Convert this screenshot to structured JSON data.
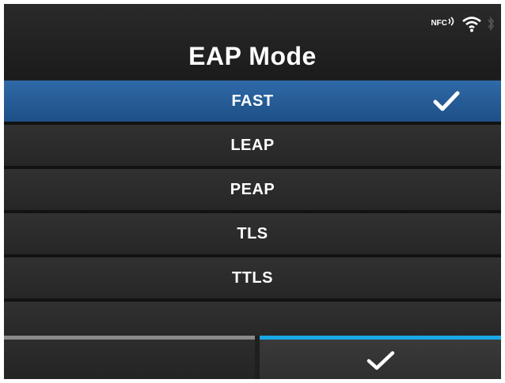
{
  "header": {
    "title": "EAP Mode",
    "nfc_label": "NFC",
    "icons": [
      "nfc-icon",
      "wifi-icon",
      "bluetooth-icon"
    ]
  },
  "options": [
    {
      "label": "FAST",
      "selected": true
    },
    {
      "label": "LEAP",
      "selected": false
    },
    {
      "label": "PEAP",
      "selected": false
    },
    {
      "label": "TLS",
      "selected": false
    },
    {
      "label": "TTLS",
      "selected": false
    }
  ],
  "footer": {
    "left_button": {
      "label": "",
      "accent": "#8a8a8a"
    },
    "right_button": {
      "icon": "checkmark-icon",
      "accent": "#19a9e6"
    }
  },
  "colors": {
    "selected_row": "#2a62a0",
    "background": "#1f1f1f"
  }
}
